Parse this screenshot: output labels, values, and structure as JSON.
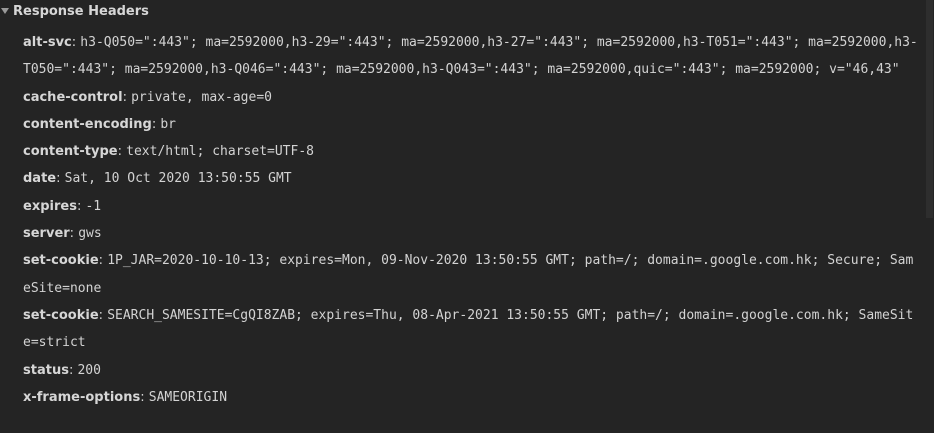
{
  "section": {
    "title": "Response Headers",
    "toggle_icon": "caret-down-icon"
  },
  "headers": [
    {
      "name": "alt-svc",
      "sep": ":",
      "value": "h3-Q050=\":443\"; ma=2592000,h3-29=\":443\"; ma=2592000,h3-27=\":443\"; ma=2592000,h3-T051=\":443\"; ma=2592000,h3-T050=\":443\"; ma=2592000,h3-Q046=\":443\"; ma=2592000,h3-Q043=\":443\"; ma=2592000,quic=\":443\"; ma=2592000; v=\"46,43\""
    },
    {
      "name": "cache-control",
      "sep": ":",
      "value": "private, max-age=0"
    },
    {
      "name": "content-encoding",
      "sep": ":",
      "value": "br"
    },
    {
      "name": "content-type",
      "sep": ":",
      "value": "text/html; charset=UTF-8"
    },
    {
      "name": "date",
      "sep": ":",
      "value": "Sat, 10 Oct 2020 13:50:55 GMT"
    },
    {
      "name": "expires",
      "sep": ":",
      "value": "-1"
    },
    {
      "name": "server",
      "sep": ":",
      "value": "gws"
    },
    {
      "name": "set-cookie",
      "sep": ":",
      "value": "1P_JAR=2020-10-10-13; expires=Mon, 09-Nov-2020 13:50:55 GMT; path=/; domain=.google.com.hk; Secure; SameSite=none"
    },
    {
      "name": "set-cookie",
      "sep": ":",
      "value": "SEARCH_SAMESITE=CgQI8ZAB; expires=Thu, 08-Apr-2021 13:50:55 GMT; path=/; domain=.google.com.hk; SameSite=strict"
    },
    {
      "name": "status",
      "sep": ":",
      "value": "200"
    },
    {
      "name": "x-frame-options",
      "sep": ":",
      "value": "SAMEORIGIN"
    }
  ],
  "colors": {
    "background": "#242424",
    "name_text": "#d6d6d6",
    "value_text": "#d3d3d3"
  }
}
